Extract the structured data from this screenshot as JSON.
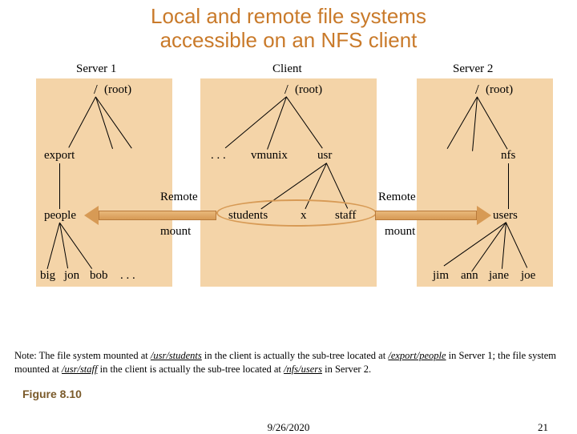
{
  "title_line1": "Local and remote file systems",
  "title_line2": "accessible on an NFS client",
  "panels": {
    "server1": {
      "label": "Server 1",
      "root": "(root)",
      "slash": "/",
      "nodes": {
        "export": "export",
        "people": "people",
        "big": "big",
        "jon": "jon",
        "bob": "bob",
        "dots": ". . ."
      }
    },
    "client": {
      "label": "Client",
      "root": "(root)",
      "slash": "/",
      "nodes": {
        "dots": ". . .",
        "vmunix": "vmunix",
        "usr": "usr",
        "students": "students",
        "x": "x",
        "staff": "staff"
      }
    },
    "server2": {
      "label": "Server 2",
      "root": "(root)",
      "slash": "/",
      "nodes": {
        "nfs": "nfs",
        "users": "users",
        "jim": "jim",
        "ann": "ann",
        "jane": "jane",
        "joe": "joe"
      }
    }
  },
  "remote_label": "Remote",
  "mount_label": "mount",
  "note": {
    "prefix": "Note: The file system mounted at ",
    "p1": "/usr/students",
    "mid1": " in the client is actually the sub-tree located at ",
    "p2": "/export/people",
    "mid2": " in Server 1; the file system mounted at ",
    "p3": "/usr/staff",
    "mid3": " in the client is actually the sub-tree located at ",
    "p4": "/nfs/users",
    "suffix": " in Server 2."
  },
  "figure_label": "Figure 8.10",
  "footer_date": "9/26/2020",
  "footer_page": "21"
}
